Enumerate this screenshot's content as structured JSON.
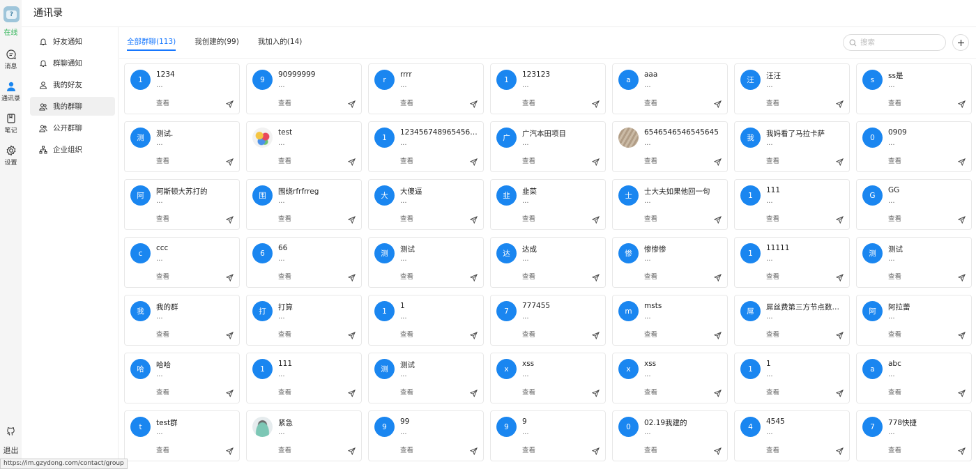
{
  "app": {
    "title": "通讯录",
    "status": "在线"
  },
  "rail": {
    "items": [
      {
        "label": "消息",
        "icon": "chat-icon"
      },
      {
        "label": "通讯录",
        "icon": "contacts-icon"
      },
      {
        "label": "笔记",
        "icon": "note-icon"
      },
      {
        "label": "设置",
        "icon": "settings-icon"
      }
    ],
    "logout": {
      "label": "退出",
      "icon": "github-icon"
    },
    "active_index": 1
  },
  "menu": {
    "items": [
      {
        "label": "好友通知",
        "icon": "bell-icon"
      },
      {
        "label": "群聊通知",
        "icon": "bell-icon"
      },
      {
        "label": "我的好友",
        "icon": "user-icon"
      },
      {
        "label": "我的群聊",
        "icon": "group-icon"
      },
      {
        "label": "公开群聊",
        "icon": "group-icon"
      },
      {
        "label": "企业组织",
        "icon": "org-icon"
      }
    ],
    "active_index": 3
  },
  "tabs": [
    {
      "label": "全部群聊(113)",
      "active": true
    },
    {
      "label": "我创建的(99)",
      "active": false
    },
    {
      "label": "我加入的(14)",
      "active": false
    }
  ],
  "search": {
    "placeholder": "搜索"
  },
  "card_labels": {
    "desc": "...",
    "view": "查看"
  },
  "accent": "#1677ff",
  "avatar_color": "#1a86f0",
  "groups": [
    {
      "avatar": "1",
      "name": "1234"
    },
    {
      "avatar": "9",
      "name": "90999999"
    },
    {
      "avatar": "r",
      "name": "rrrr"
    },
    {
      "avatar": "1",
      "name": "123123"
    },
    {
      "avatar": "a",
      "name": "aaa"
    },
    {
      "avatar": "汪",
      "name": "汪汪"
    },
    {
      "avatar": "s",
      "name": "ss是"
    },
    {
      "avatar": "测",
      "name": "测试."
    },
    {
      "avatar": "",
      "image": "img-a",
      "name": "test"
    },
    {
      "avatar": "1",
      "name": "1234567489654565..."
    },
    {
      "avatar": "广",
      "name": "广汽本田项目"
    },
    {
      "avatar": "",
      "image": "img-b",
      "name": "6546546546545645"
    },
    {
      "avatar": "我",
      "name": "我妈看了马拉卡萨"
    },
    {
      "avatar": "0",
      "name": "0909"
    },
    {
      "avatar": "阿",
      "name": "阿斯顿大苏打的"
    },
    {
      "avatar": "围",
      "name": "围绕rfrfrreg"
    },
    {
      "avatar": "大",
      "name": "大傻逼"
    },
    {
      "avatar": "韭",
      "name": "韭菜"
    },
    {
      "avatar": "士",
      "name": "士大夫如果他回一句"
    },
    {
      "avatar": "1",
      "name": "111"
    },
    {
      "avatar": "G",
      "name": "GG"
    },
    {
      "avatar": "c",
      "name": "ccc"
    },
    {
      "avatar": "6",
      "name": "66"
    },
    {
      "avatar": "测",
      "name": "测试"
    },
    {
      "avatar": "达",
      "name": "达成"
    },
    {
      "avatar": "惨",
      "name": "惨惨惨"
    },
    {
      "avatar": "1",
      "name": "11111"
    },
    {
      "avatar": "测",
      "name": "测试"
    },
    {
      "avatar": "我",
      "name": "我的群"
    },
    {
      "avatar": "打",
      "name": "打算"
    },
    {
      "avatar": "1",
      "name": "1"
    },
    {
      "avatar": "7",
      "name": "777455"
    },
    {
      "avatar": "m",
      "name": "msts"
    },
    {
      "avatar": "屌",
      "name": "屌丝费第三方节点数据..."
    },
    {
      "avatar": "阿",
      "name": "阿拉蕾"
    },
    {
      "avatar": "哈",
      "name": "哈哈"
    },
    {
      "avatar": "1",
      "name": "111"
    },
    {
      "avatar": "测",
      "name": "测试"
    },
    {
      "avatar": "x",
      "name": "xss"
    },
    {
      "avatar": "x",
      "name": "xss"
    },
    {
      "avatar": "1",
      "name": "1"
    },
    {
      "avatar": "a",
      "name": "abc"
    },
    {
      "avatar": "t",
      "name": "test群"
    },
    {
      "avatar": "",
      "image": "img-c",
      "name": "紧急"
    },
    {
      "avatar": "9",
      "name": "99"
    },
    {
      "avatar": "9",
      "name": "9"
    },
    {
      "avatar": "0",
      "name": "02.19我建的"
    },
    {
      "avatar": "4",
      "name": "4545"
    },
    {
      "avatar": "7",
      "name": "778快捷"
    }
  ],
  "status_url": "https://im.gzydong.com/contact/group"
}
